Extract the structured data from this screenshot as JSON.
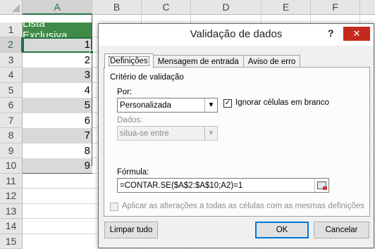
{
  "spreadsheet": {
    "columns": [
      "A",
      "B",
      "C",
      "D",
      "E",
      "F"
    ],
    "rows": [
      "1",
      "2",
      "3",
      "4",
      "5",
      "6",
      "7",
      "8",
      "9",
      "10",
      "11",
      "12",
      "13",
      "14",
      "15"
    ],
    "header_cell": "Lista Exclusiva",
    "values": [
      "1",
      "2",
      "3",
      "4",
      "5",
      "6",
      "7",
      "8",
      "9"
    ],
    "colors": {
      "header_fill": "#3f8a47",
      "band_fill": "#d9d9d9",
      "selection": "#217346"
    }
  },
  "dialog": {
    "title": "Validação de dados",
    "help": "?",
    "close": "✕",
    "tabs": [
      {
        "label": "Definições"
      },
      {
        "label": "Mensagem de entrada"
      },
      {
        "label": "Aviso de erro"
      }
    ],
    "criteria_title": "Critério de validação",
    "allow_label": "Por:",
    "allow_value": "Personalizada",
    "ignore_blank_label": "Ignorar células em branco",
    "ignore_blank_checked": true,
    "data_label": "Dados:",
    "data_value": "situa-se entre",
    "formula_label": "Fórmula:",
    "formula_value": "=CONTAR.SE($A$2:$A$10;A2)=1",
    "apply_all_label": "Aplicar as alterações a todas as células com as mesmas definições",
    "apply_all_checked": false,
    "clear_all": "Limpar tudo",
    "ok": "OK",
    "cancel": "Cancelar",
    "dropdown_icon": "chevron-down-icon",
    "ref_icon": "collapse-dialog-icon"
  }
}
